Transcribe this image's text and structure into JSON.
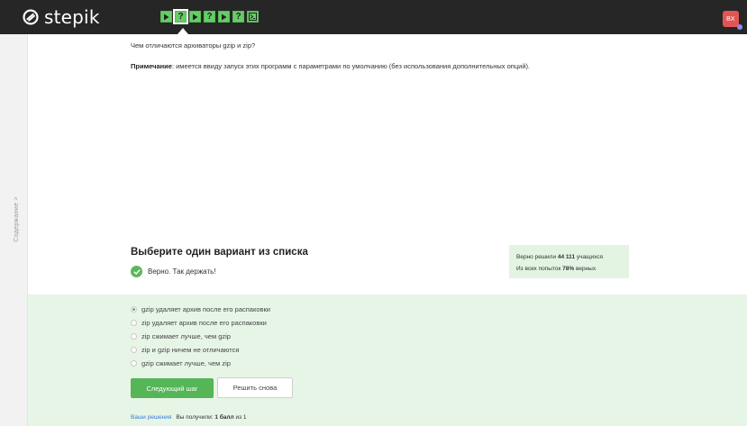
{
  "header": {
    "logo_text": "stepik",
    "avatar_initials": "ВХ",
    "steps": [
      {
        "type": "play",
        "state": "passed"
      },
      {
        "type": "quiz",
        "state": "passed",
        "active": true
      },
      {
        "type": "play",
        "state": "passed"
      },
      {
        "type": "quiz",
        "state": "passed"
      },
      {
        "type": "play",
        "state": "passed"
      },
      {
        "type": "quiz",
        "state": "passed"
      },
      {
        "type": "code",
        "state": "passed"
      }
    ],
    "step_icons": {
      "play": "play-icon",
      "quiz": "question-icon",
      "code": "code-icon"
    },
    "accent_color": "#66cc66"
  },
  "sidebar": {
    "toggle_label": "Содержание >"
  },
  "lesson": {
    "question": "Чем отличаются архиваторы gzip и zip?",
    "note_label": "Примечание",
    "note_text": ": имеется ввиду запуск этих программ с параметрами по умолчанию (без использования дополнительных опций)."
  },
  "quiz": {
    "title": "Выберите один вариант из списка",
    "verdict": "Верно. Так держать!",
    "stats": {
      "solved_prefix": "Верно решили ",
      "solved_count": "44 111",
      "solved_suffix": " учащихся",
      "attempts_prefix": "Из всех попыток ",
      "attempts_percent": "78%",
      "attempts_suffix": " верных"
    },
    "options": [
      {
        "label": "gzip удаляет архив после его распаковки",
        "checked": true
      },
      {
        "label": "zip удаляет архив после его распаковки",
        "checked": false
      },
      {
        "label": "zip сжимает лучше, чем gzip",
        "checked": false
      },
      {
        "label": "zip и gzip ничем не отличаются",
        "checked": false
      },
      {
        "label": "gzip сжимает лучше, чем zip",
        "checked": false
      }
    ],
    "next_button": "Следующий шаг",
    "retry_button": "Решить снова",
    "footer": {
      "solutions_link": "Ваши решения",
      "score_prefix": "Вы получили:",
      "score_value": "1 балл",
      "score_suffix": "из 1"
    }
  }
}
